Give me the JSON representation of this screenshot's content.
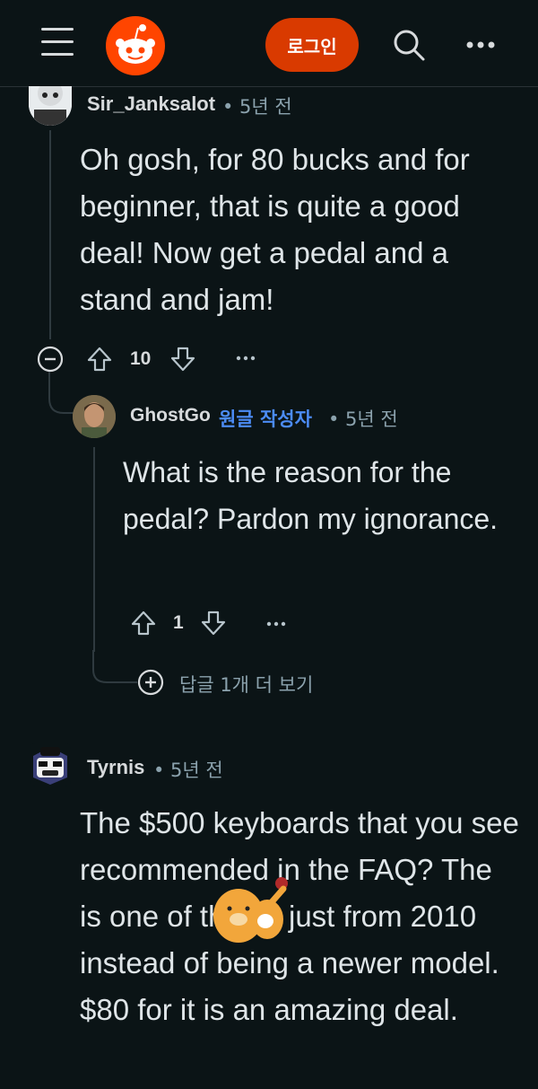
{
  "header": {
    "login_label": "로그인",
    "icons": {
      "menu": "hamburger-icon",
      "logo": "reddit-logo",
      "search": "search-icon",
      "more": "more-icon"
    },
    "brand_color": "#ff4500"
  },
  "comments": [
    {
      "author": "Sir_Janksalot",
      "meta": "• 5년 전",
      "body": "Oh gosh, for 80 bucks and for beginner, that is quite a good deal! Now get a pedal and a stand and jam!",
      "votes": "10"
    },
    {
      "author": "GhostGo",
      "op_badge": "원글 작성자",
      "meta": "• 5년 전",
      "body": "What is the reason for the pedal? Pardon my ignorance.",
      "votes": "1",
      "more_replies": "답글 1개 더 보기"
    },
    {
      "author": "Tyrnis",
      "meta": "• 5년 전",
      "body": "The $500 keyboards that you see recommended in the FAQ? The  is one of those, just from 2010 instead of being a newer model. $80 for it is an amazing deal."
    }
  ],
  "colors": {
    "background": "#0b1416",
    "accent": "#d93a00",
    "op_badge": "#4c8cf5"
  }
}
